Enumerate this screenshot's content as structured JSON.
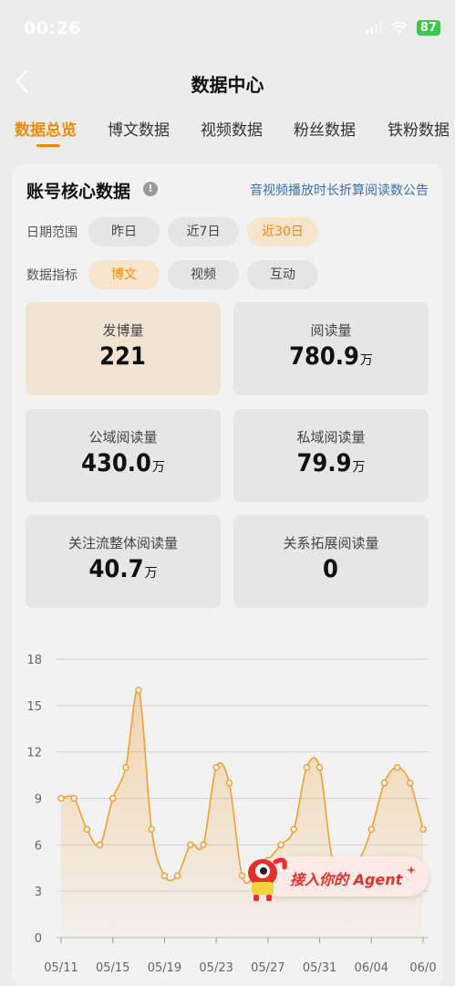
{
  "status_bar": {
    "time": "00:26",
    "battery": "87"
  },
  "header": {
    "title": "数据中心"
  },
  "tabs": [
    {
      "label": "数据总览",
      "active": true
    },
    {
      "label": "博文数据",
      "active": false
    },
    {
      "label": "视频数据",
      "active": false
    },
    {
      "label": "粉丝数据",
      "active": false
    },
    {
      "label": "铁粉数据",
      "active": false
    }
  ],
  "card": {
    "title": "账号核心数据",
    "info_icon": "!",
    "notice_link": "音视频播放时长折算阅读数公告",
    "date_range": {
      "label": "日期范围",
      "options": [
        "昨日",
        "近7日",
        "近30日"
      ],
      "selected": "近30日"
    },
    "indicator": {
      "label": "数据指标",
      "options": [
        "博文",
        "视频",
        "互动"
      ],
      "selected": "博文"
    },
    "metrics": [
      {
        "label": "发博量",
        "value": "221",
        "unit": ""
      },
      {
        "label": "阅读量",
        "value": "780.9",
        "unit": "万"
      },
      {
        "label": "公域阅读量",
        "value": "430.0",
        "unit": "万"
      },
      {
        "label": "私域阅读量",
        "value": "79.9",
        "unit": "万"
      },
      {
        "label": "关注流整体阅读量",
        "value": "40.7",
        "unit": "万"
      },
      {
        "label": "关系拓展阅读量",
        "value": "0",
        "unit": ""
      }
    ]
  },
  "agent_button": {
    "label": "接入你的 Agent"
  },
  "colors": {
    "accent": "#f08a00",
    "link": "#3d6fa8",
    "agent_text": "#e8302b"
  },
  "chart_data": {
    "type": "area",
    "ylim": [
      0,
      18
    ],
    "y_ticks": [
      0,
      3,
      6,
      9,
      12,
      15,
      18
    ],
    "x_tick_labels": [
      "05/11",
      "05/15",
      "05/19",
      "05/23",
      "05/27",
      "05/31",
      "06/04",
      "06/0"
    ],
    "x_tick_index": [
      0,
      4,
      8,
      12,
      16,
      20,
      24,
      28
    ],
    "values": [
      9,
      9,
      7,
      6,
      9,
      11,
      16,
      7,
      4,
      4,
      6,
      6,
      11,
      10,
      4,
      4,
      5,
      6,
      7,
      11,
      11,
      5,
      5,
      5,
      7,
      10,
      11,
      10,
      7
    ],
    "color": "#f0a030",
    "grid": true
  }
}
